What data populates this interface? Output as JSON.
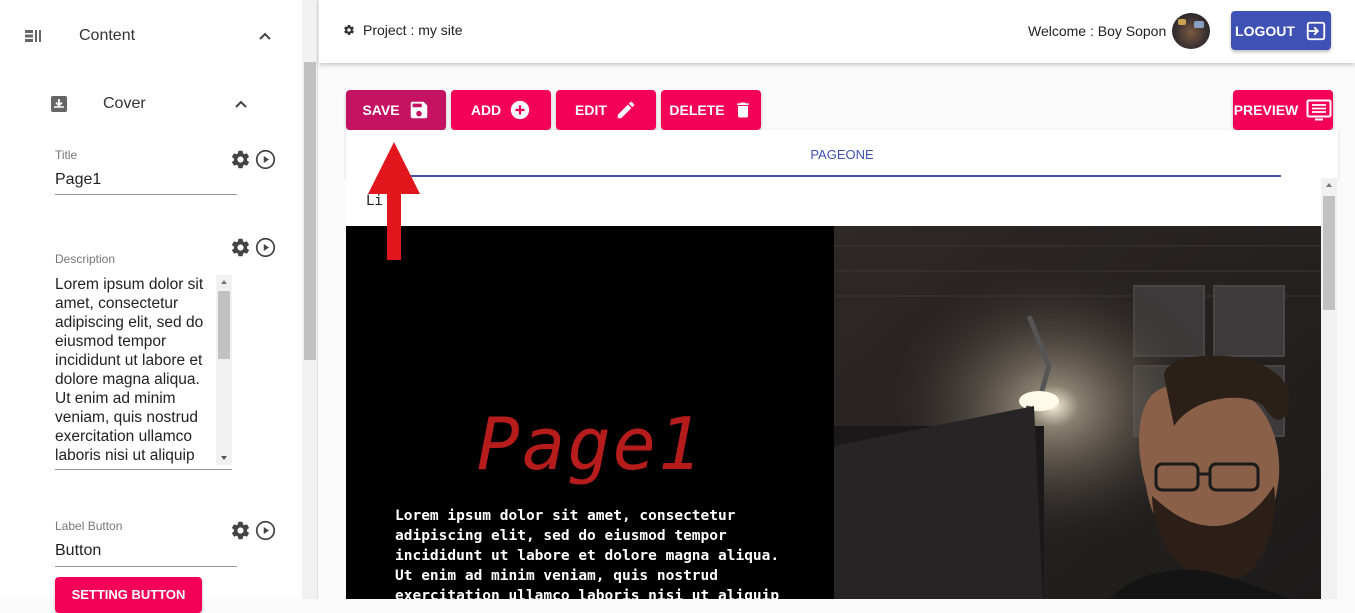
{
  "sidebar": {
    "content_label": "Content",
    "cover_label": "Cover",
    "title_label": "Title",
    "title_value": "Page1",
    "description_label": "Description",
    "description_value": "Lorem ipsum dolor sit amet, consectetur adipiscing elit, sed do eiusmod tempor incididunt ut labore et dolore magna aliqua. Ut enim ad minim veniam, quis nostrud exercitation ullamco laboris nisi ut aliquip",
    "label_button_label": "Label Button",
    "label_button_value": "Button",
    "setting_button_label": "SETTING BUTTON"
  },
  "header": {
    "project_text": "Project : my site",
    "welcome_text": "Welcome : Boy Sopon",
    "logout_label": "LOGOUT"
  },
  "toolbar": {
    "save_label": "SAVE",
    "add_label": "ADD",
    "edit_label": "EDIT",
    "delete_label": "DELETE",
    "preview_label": "PREVIEW"
  },
  "tabs": [
    {
      "label": "PAGEONE",
      "active": true
    }
  ],
  "page": {
    "top_text": "Li",
    "cover_title": "Page1",
    "cover_text": "Lorem ipsum dolor sit amet, consectetur adipiscing elit, sed do eiusmod tempor incididunt ut labore et dolore magna aliqua. Ut enim ad minim veniam, quis nostrud exercitation ullamco laboris nisi ut aliquip ex ea commodo"
  },
  "colors": {
    "accent_pink": "#f50057",
    "save_pink": "#c51162",
    "logout_blue": "#3f51b5",
    "cover_title_red": "#b71c1c",
    "arrow_red": "#e3151c"
  },
  "icons": [
    "list-icon",
    "chevron-up-icon",
    "inbox-download-icon",
    "gear-icon",
    "play-circle-icon",
    "floppy-disk-icon",
    "add-circle-icon",
    "pencil-icon",
    "trash-icon",
    "preview-icon",
    "logout-icon"
  ]
}
